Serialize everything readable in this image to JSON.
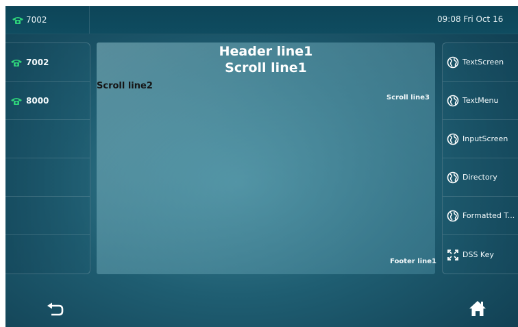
{
  "status_bar": {
    "account": "7002",
    "clock": "09:08 Fri Oct 16"
  },
  "line_keys": [
    {
      "label": "7002",
      "icon": "phone-icon"
    },
    {
      "label": "8000",
      "icon": "phone-icon"
    },
    {
      "label": ""
    },
    {
      "label": ""
    },
    {
      "label": ""
    },
    {
      "label": ""
    }
  ],
  "content": {
    "header": "Header line1",
    "scroll1": "Scroll line1",
    "scroll2": "Scroll line2",
    "scroll3": "Scroll line3",
    "footer": "Footer line1"
  },
  "soft_keys": [
    {
      "label": "TextScreen",
      "icon": "globe-icon"
    },
    {
      "label": "TextMenu",
      "icon": "globe-icon"
    },
    {
      "label": "InputScreen",
      "icon": "globe-icon"
    },
    {
      "label": "Directory",
      "icon": "globe-icon"
    },
    {
      "label": "Formatted T...",
      "icon": "globe-icon"
    },
    {
      "label": "DSS Key",
      "icon": "expand-icon"
    }
  ],
  "bottom_bar": {
    "back_icon": "back-arrow-icon",
    "home_icon": "home-icon"
  },
  "colors": {
    "phone_green": "#2fd47a",
    "background": "#1f5e72"
  }
}
